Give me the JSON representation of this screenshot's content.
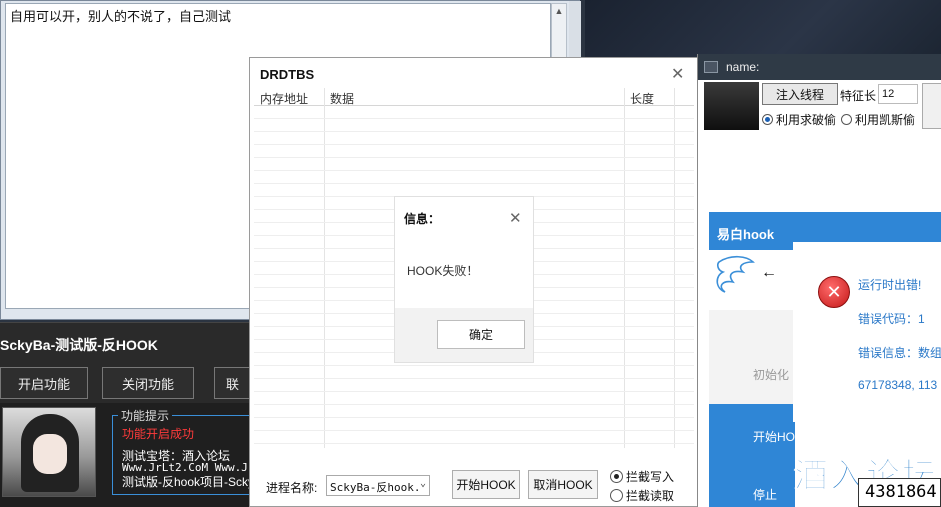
{
  "notepad": {
    "text": "自用可以开，别人的不说了，自己测试"
  },
  "scky": {
    "title": "SckyBa-测试版-反HOOK",
    "buttons": [
      "开启功能",
      "关闭功能",
      "联"
    ],
    "tips": {
      "legend": "功能提示",
      "status": "功能开启成功",
      "lines": [
        "测试宝塔：酒入论坛",
        "Www.JrLt2.CoM    Www.J",
        "测试版-反hook项目-Scky"
      ]
    }
  },
  "drdtbs": {
    "title": "DRDTBS",
    "close": "✕",
    "columns": [
      "内存地址",
      "数据",
      "长度"
    ],
    "process_label": "进程名称:",
    "process_value": "SckyBa-反hook.",
    "start_hook": "开始HOOK",
    "cancel_hook": "取消HOOK",
    "radio_write": "拦截写入",
    "radio_read": "拦截读取"
  },
  "dialog": {
    "title": "信息：",
    "close": "✕",
    "message": "HOOK失败！",
    "ok": "确定"
  },
  "namewin": {
    "title": "name:",
    "inject": "注入线程",
    "feature_label": "特征长",
    "feature_value": "12",
    "radio1": "利用求破偷",
    "radio2": "利用凯斯偷"
  },
  "hook": {
    "title": "易白hook",
    "init": "初始化",
    "start": "开始HO",
    "stop": "停止",
    "arrow": "←"
  },
  "error": {
    "line1": "运行时出错!",
    "line2": "错误代码：1",
    "line3": "错误信息：数组",
    "line4": "67178348, 113"
  },
  "watermark": "酒入论坛",
  "counter": "4381864"
}
